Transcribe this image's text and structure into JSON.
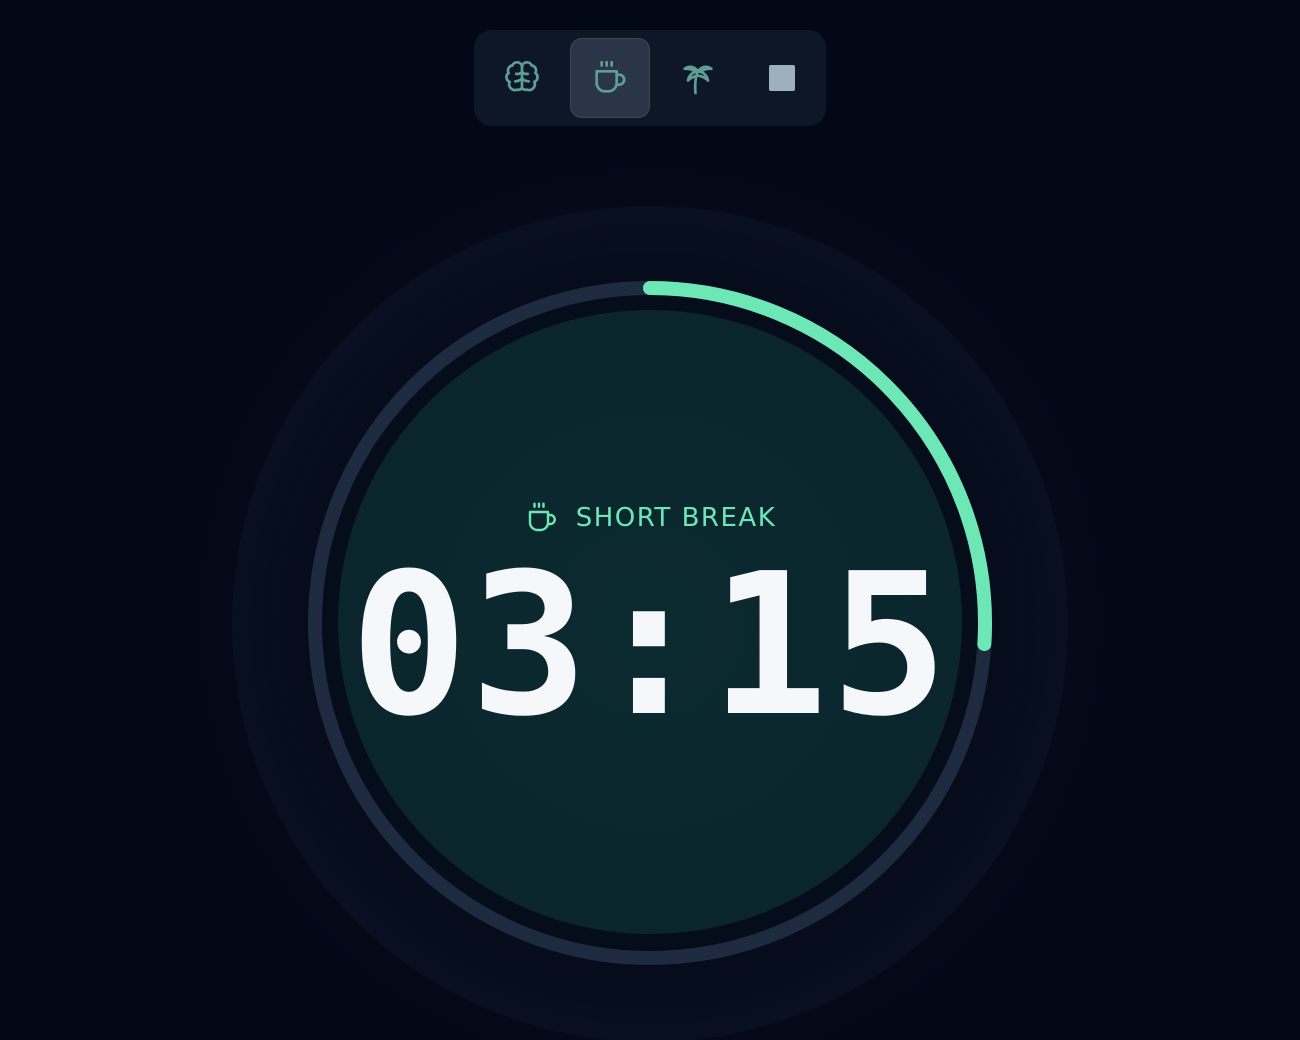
{
  "toolbar": {
    "modes": [
      {
        "icon": "brain-icon",
        "active": false
      },
      {
        "icon": "coffee-cup-icon",
        "active": true
      },
      {
        "icon": "palm-tree-icon",
        "active": false
      },
      {
        "icon": "stop-icon",
        "active": false
      }
    ]
  },
  "timer": {
    "mode_label": "SHORT BREAK",
    "mode_icon": "coffee-cup-icon",
    "time": "03:15",
    "progress_fraction": 0.26
  },
  "colors": {
    "background": "#030817",
    "accent": "#6ee7b7",
    "track": "#1e2a40",
    "face": "#0a272d",
    "text": "#f5f7fb",
    "toolbar": "#0e1728",
    "toolbar_active": "#2a3647",
    "icon": "#5f9e93"
  }
}
